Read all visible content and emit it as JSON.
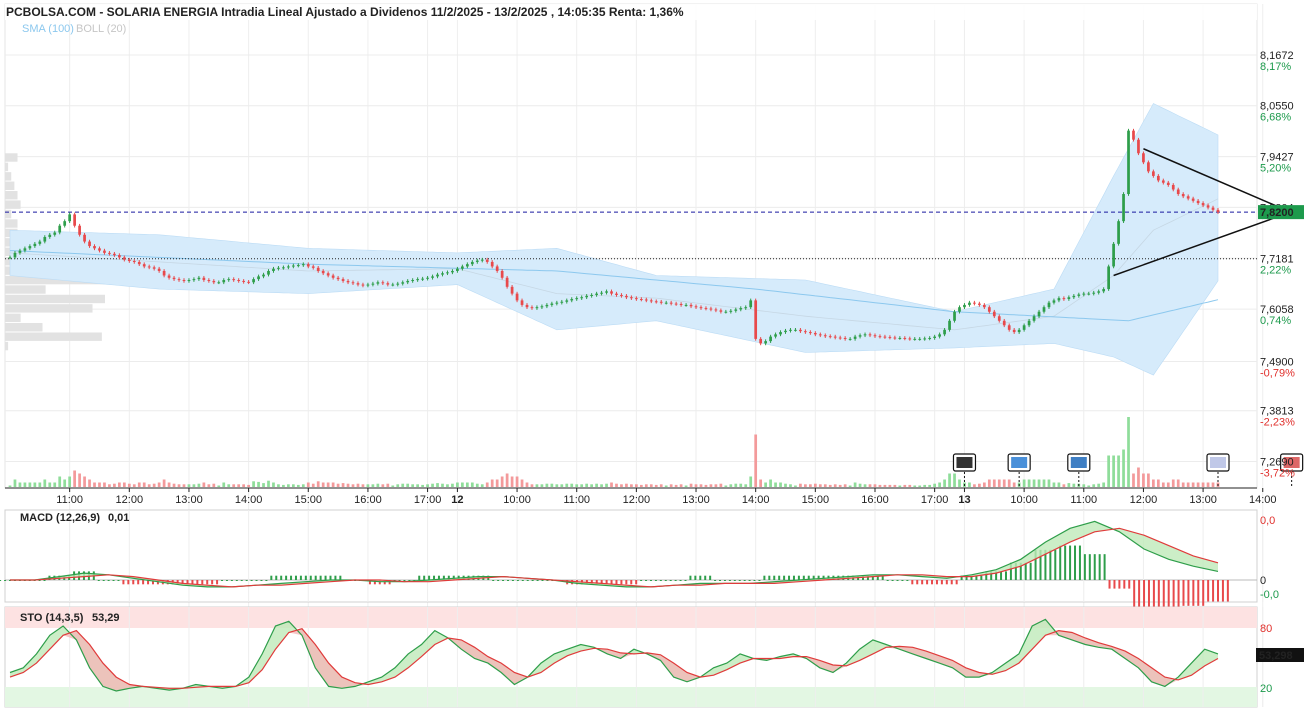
{
  "header": {
    "title": "PCBOLSA.COM - SOLARIA ENERGIA Intradia Lineal Ajustado a Dividenos 11/2/2025 - 13/2/2025 , 14:05:35 Renta: 1,36%",
    "sma_label": "SMA (100)",
    "boll_label": "BOLL (20)"
  },
  "colors": {
    "up": "#2e9e4a",
    "down": "#e8494b",
    "band_fill": "#d6ebfb",
    "sma_line": "#8cc8ee",
    "price_line": "#1a1aa0",
    "pct_up": "#1d9a4c",
    "pct_down": "#e0302c"
  },
  "chart_data": [
    {
      "type": "candlestick",
      "title": "PCBOLSA.COM - SOLARIA ENERGIA Intradia Lineal Ajustado a Dividenos 11/2/2025 - 13/2/2025 , 14:05:35 Renta: 1,36%",
      "y_ticks": [
        {
          "value": 8.1672,
          "label": "8,1672",
          "pct": "8,17%"
        },
        {
          "value": 8.055,
          "label": "8,0550",
          "pct": "6,68%"
        },
        {
          "value": 7.9427,
          "label": "7,9427",
          "pct": "5,20%"
        },
        {
          "value": 7.8304,
          "label": "7,8304",
          "pct": ""
        },
        {
          "value": 7.7181,
          "label": "7,7181",
          "pct": "2,22%"
        },
        {
          "value": 7.6058,
          "label": "7,6058",
          "pct": "0,74%"
        },
        {
          "value": 7.49,
          "label": "7,4900",
          "pct": "-0,79%"
        },
        {
          "value": 7.3813,
          "label": "7,3813",
          "pct": "-2,23%"
        },
        {
          "value": 7.269,
          "label": "7,2690",
          "pct": "-3,72%"
        }
      ],
      "ylim": [
        7.215,
        8.24
      ],
      "current_price": 7.82,
      "current_price_label": "7,8200",
      "reference_line": 7.717,
      "x_labels": [
        {
          "label": "11:00",
          "idx": 12
        },
        {
          "label": "12:00",
          "idx": 24
        },
        {
          "label": "13:00",
          "idx": 36
        },
        {
          "label": "14:00",
          "idx": 48
        },
        {
          "label": "15:00",
          "idx": 60
        },
        {
          "label": "16:00",
          "idx": 72
        },
        {
          "label": "17:00",
          "idx": 84
        },
        {
          "label": "12",
          "idx": 90,
          "bold": true
        },
        {
          "label": "10:00",
          "idx": 102
        },
        {
          "label": "11:00",
          "idx": 114
        },
        {
          "label": "12:00",
          "idx": 126
        },
        {
          "label": "13:00",
          "idx": 138
        },
        {
          "label": "14:00",
          "idx": 150
        },
        {
          "label": "15:00",
          "idx": 162
        },
        {
          "label": "16:00",
          "idx": 174
        },
        {
          "label": "17:00",
          "idx": 186
        },
        {
          "label": "13",
          "idx": 192,
          "bold": true
        },
        {
          "label": "10:00",
          "idx": 204
        },
        {
          "label": "11:00",
          "idx": 216
        },
        {
          "label": "12:00",
          "idx": 228
        },
        {
          "label": "13:00",
          "idx": 240
        },
        {
          "label": "14:00",
          "idx": 252
        }
      ],
      "closes": [
        7.72,
        7.73,
        7.735,
        7.74,
        7.745,
        7.75,
        7.755,
        7.765,
        7.77,
        7.775,
        7.79,
        7.8,
        7.815,
        7.79,
        7.77,
        7.755,
        7.745,
        7.74,
        7.735,
        7.73,
        7.728,
        7.725,
        7.72,
        7.715,
        7.712,
        7.71,
        7.705,
        7.7,
        7.698,
        7.695,
        7.69,
        7.68,
        7.675,
        7.672,
        7.67,
        7.668,
        7.67,
        7.672,
        7.675,
        7.67,
        7.668,
        7.665,
        7.665,
        7.67,
        7.672,
        7.67,
        7.668,
        7.666,
        7.665,
        7.672,
        7.678,
        7.682,
        7.69,
        7.695,
        7.697,
        7.698,
        7.7,
        7.702,
        7.703,
        7.705,
        7.7,
        7.697,
        7.69,
        7.685,
        7.68,
        7.675,
        7.672,
        7.668,
        7.665,
        7.663,
        7.66,
        7.658,
        7.66,
        7.662,
        7.665,
        7.663,
        7.66,
        7.66,
        7.662,
        7.665,
        7.668,
        7.67,
        7.672,
        7.673,
        7.675,
        7.678,
        7.682,
        7.685,
        7.687,
        7.69,
        7.695,
        7.7,
        7.705,
        7.71,
        7.713,
        7.715,
        7.71,
        7.7,
        7.69,
        7.675,
        7.655,
        7.64,
        7.625,
        7.615,
        7.61,
        7.608,
        7.61,
        7.612,
        7.615,
        7.618,
        7.62,
        7.622,
        7.625,
        7.628,
        7.63,
        7.632,
        7.635,
        7.637,
        7.64,
        7.642,
        7.645,
        7.64,
        7.637,
        7.635,
        7.632,
        7.63,
        7.628,
        7.627,
        7.625,
        7.623,
        7.622,
        7.62,
        7.62,
        7.618,
        7.617,
        7.615,
        7.615,
        7.612,
        7.61,
        7.608,
        7.607,
        7.605,
        7.603,
        7.6,
        7.6,
        7.602,
        7.605,
        7.608,
        7.61,
        7.625,
        7.54,
        7.53,
        7.535,
        7.545,
        7.55,
        7.555,
        7.558,
        7.56,
        7.56,
        7.557,
        7.555,
        7.553,
        7.55,
        7.548,
        7.546,
        7.545,
        7.543,
        7.542,
        7.54,
        7.54,
        7.545,
        7.548,
        7.55,
        7.548,
        7.546,
        7.545,
        7.544,
        7.543,
        7.542,
        7.542,
        7.541,
        7.54,
        7.54,
        7.54,
        7.541,
        7.542,
        7.545,
        7.55,
        7.56,
        7.58,
        7.6,
        7.61,
        7.615,
        7.62,
        7.618,
        7.615,
        7.61,
        7.6,
        7.59,
        7.58,
        7.57,
        7.56,
        7.555,
        7.56,
        7.57,
        7.58,
        7.59,
        7.6,
        7.61,
        7.62,
        7.625,
        7.63,
        7.628,
        7.632,
        7.635,
        7.638,
        7.64,
        7.64,
        7.642,
        7.645,
        7.65,
        7.7,
        7.75,
        7.8,
        7.86,
        8.0,
        7.98,
        7.95,
        7.93,
        7.91,
        7.9,
        7.89,
        7.885,
        7.88,
        7.87,
        7.86,
        7.855,
        7.85,
        7.845,
        7.84,
        7.835,
        7.83,
        7.825,
        7.82
      ],
      "bollinger": [
        {
          "idx": 0,
          "up": 7.78,
          "mid": 7.73,
          "lo": 7.68
        },
        {
          "idx": 30,
          "up": 7.77,
          "mid": 7.71,
          "lo": 7.65
        },
        {
          "idx": 60,
          "up": 7.74,
          "mid": 7.69,
          "lo": 7.64
        },
        {
          "idx": 90,
          "up": 7.73,
          "mid": 7.695,
          "lo": 7.66
        },
        {
          "idx": 110,
          "up": 7.74,
          "mid": 7.64,
          "lo": 7.56
        },
        {
          "idx": 130,
          "up": 7.68,
          "mid": 7.63,
          "lo": 7.58
        },
        {
          "idx": 160,
          "up": 7.67,
          "mid": 7.59,
          "lo": 7.51
        },
        {
          "idx": 190,
          "up": 7.6,
          "mid": 7.56,
          "lo": 7.52
        },
        {
          "idx": 210,
          "up": 7.65,
          "mid": 7.59,
          "lo": 7.53
        },
        {
          "idx": 222,
          "up": 7.9,
          "mid": 7.68,
          "lo": 7.5
        },
        {
          "idx": 230,
          "up": 8.06,
          "mid": 7.78,
          "lo": 7.46
        },
        {
          "idx": 245,
          "up": 7.98,
          "mid": 7.86,
          "lo": 7.7
        },
        {
          "idx": 256,
          "up": 7.92,
          "mid": 7.86,
          "lo": 7.79
        }
      ],
      "sma100": [
        {
          "idx": 0,
          "v": 7.735
        },
        {
          "idx": 60,
          "v": 7.705
        },
        {
          "idx": 110,
          "v": 7.69
        },
        {
          "idx": 150,
          "v": 7.65
        },
        {
          "idx": 190,
          "v": 7.6
        },
        {
          "idx": 225,
          "v": 7.58
        },
        {
          "idx": 256,
          "v": 7.66
        }
      ],
      "triangle": {
        "apex_idx": 256,
        "apex_v": 7.82,
        "top_idx": 228,
        "top_v": 7.96,
        "bot_idx": 222,
        "bot_v": 7.68
      }
    },
    {
      "type": "line",
      "title": "MACD (12,26,9)",
      "value_label": "0,01",
      "y_ticks": [
        "0,0",
        "0",
        "-0,0"
      ],
      "macd": [
        0,
        0,
        0.002,
        0.004,
        0.003,
        0.001,
        -0.001,
        -0.003,
        -0.004,
        -0.004,
        -0.003,
        -0.002,
        -0.001,
        0,
        0,
        -0.001,
        -0.001,
        0,
        0.001,
        0.002,
        0.002,
        0.001,
        0,
        -0.002,
        -0.003,
        -0.004,
        -0.004,
        -0.003,
        -0.002,
        -0.002,
        -0.002,
        -0.001,
        0,
        0.001,
        0.002,
        0.003,
        0.003,
        0.002,
        0.001,
        0.003,
        0.006,
        0.012,
        0.022,
        0.03,
        0.034,
        0.028,
        0.018,
        0.012,
        0.008,
        0.005
      ],
      "signal": [
        0,
        0,
        0.001,
        0.002,
        0.003,
        0.002,
        0,
        -0.002,
        -0.003,
        -0.004,
        -0.003,
        -0.003,
        -0.002,
        -0.001,
        0,
        0,
        -0.001,
        -0.001,
        0,
        0.001,
        0.002,
        0.001,
        0,
        -0.001,
        -0.002,
        -0.003,
        -0.004,
        -0.003,
        -0.003,
        -0.002,
        -0.002,
        -0.002,
        -0.001,
        0,
        0.001,
        0.002,
        0.003,
        0.003,
        0.002,
        0.002,
        0.004,
        0.008,
        0.015,
        0.022,
        0.028,
        0.03,
        0.026,
        0.02,
        0.014,
        0.01
      ]
    },
    {
      "type": "line",
      "title": "STO (14,3,5)",
      "value_label": "53,29",
      "current_label": "53,298",
      "y_ticks": [
        "80",
        "20"
      ],
      "k": [
        35,
        40,
        55,
        75,
        85,
        70,
        40,
        20,
        15,
        18,
        20,
        18,
        16,
        18,
        22,
        20,
        18,
        20,
        30,
        55,
        85,
        90,
        75,
        40,
        20,
        18,
        20,
        25,
        30,
        40,
        55,
        65,
        80,
        72,
        60,
        50,
        45,
        35,
        22,
        30,
        45,
        55,
        60,
        65,
        62,
        55,
        50,
        60,
        55,
        48,
        30,
        25,
        30,
        40,
        45,
        55,
        50,
        48,
        52,
        55,
        50,
        40,
        35,
        45,
        60,
        70,
        65,
        60,
        55,
        50,
        45,
        40,
        30,
        30,
        35,
        45,
        55,
        85,
        92,
        75,
        70,
        65,
        62,
        60,
        50,
        40,
        25,
        20,
        30,
        45,
        60,
        55
      ],
      "d": [
        30,
        35,
        45,
        60,
        75,
        80,
        65,
        45,
        30,
        22,
        20,
        19,
        18,
        18,
        19,
        20,
        20,
        20,
        24,
        38,
        60,
        78,
        82,
        65,
        45,
        30,
        24,
        22,
        25,
        30,
        40,
        52,
        65,
        72,
        70,
        62,
        52,
        45,
        35,
        30,
        35,
        45,
        53,
        58,
        61,
        60,
        56,
        55,
        56,
        54,
        45,
        35,
        30,
        32,
        38,
        45,
        50,
        50,
        50,
        52,
        52,
        48,
        43,
        42,
        48,
        55,
        62,
        63,
        62,
        58,
        53,
        48,
        40,
        35,
        33,
        37,
        45,
        60,
        75,
        80,
        78,
        72,
        67,
        63,
        58,
        50,
        40,
        30,
        27,
        32,
        42,
        50
      ]
    }
  ]
}
